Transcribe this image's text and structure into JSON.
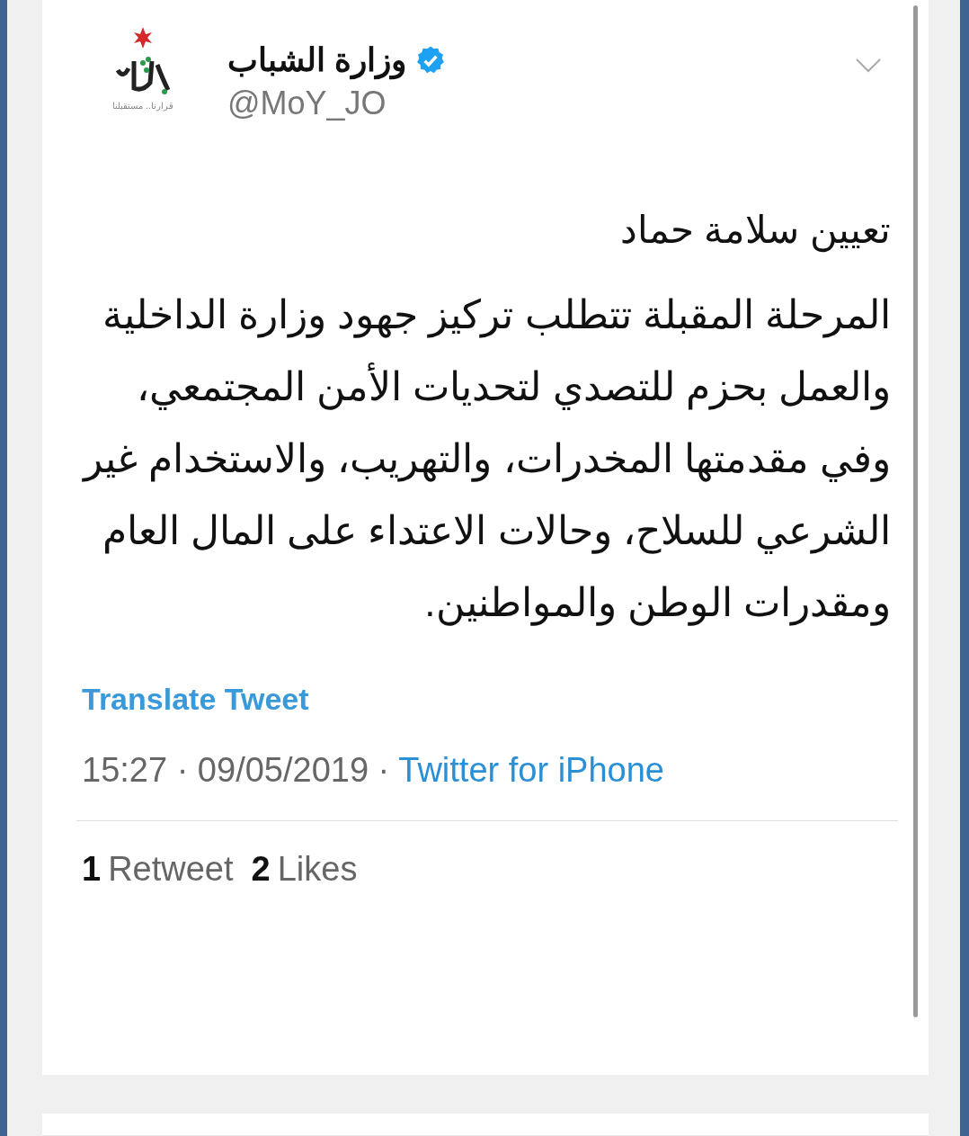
{
  "tweet": {
    "author_name": "وزارة الشباب",
    "verified": true,
    "handle": "@MoY_JO",
    "logo_tagline": "قرارنا.. مستقبلنا",
    "title": "تعيين سلامة حماد",
    "body": "المرحلة المقبلة تتطلب تركيز جهود وزارة الداخلية والعمل بحزم للتصدي لتحديات الأمن المجتمعي، وفي مقدمتها المخدرات، والتهريب، والاستخدام غير الشرعي للسلاح، وحالات الاعتداء على المال العام ومقدرات الوطن والمواطنين.",
    "translate": "Translate Tweet",
    "time": "15:27 · 09/05/2019 ·",
    "source": "Twitter for iPhone",
    "retweets": {
      "count": "1",
      "label": "Retweet"
    },
    "likes": {
      "count": "2",
      "label": "Likes"
    }
  }
}
